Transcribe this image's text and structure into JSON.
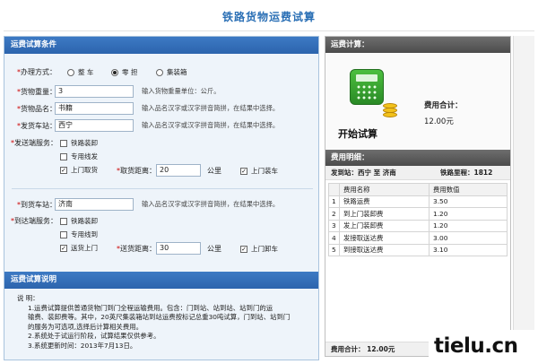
{
  "page": {
    "title": "铁路货物运费试算"
  },
  "conditions": {
    "title": "运费试算条件",
    "method": {
      "label": "办理方式：",
      "options": [
        "整 车",
        "零 担",
        "集装箱"
      ],
      "selected_index": 1
    },
    "weight": {
      "label": "货物重量：",
      "value": "3",
      "hint": "输入货物重量单位：公斤。"
    },
    "goods": {
      "label": "货物品名：",
      "value": "书籍",
      "hint": "输入品名汉字或汉字拼音简拼，在结果中选择。"
    },
    "origin": {
      "label": "发货车站：",
      "value": "西宁",
      "hint": "输入品名汉字或汉字拼音简拼，在结果中选择。"
    },
    "send_service": {
      "label": "发送端服务：",
      "options": [
        "铁路装卸",
        "专用线发",
        "上门取货"
      ],
      "checked": [
        false,
        false,
        true
      ],
      "distance_label": "取货距离：",
      "distance_value": "20",
      "distance_unit": "公里",
      "extra_label": "上门装车",
      "extra_checked": true
    },
    "dest": {
      "label": "到货车站：",
      "value": "济南",
      "hint": "输入品名汉字或汉字拼音简拼，在结果中选择。"
    },
    "arrive_service": {
      "label": "到达端服务：",
      "options": [
        "铁路装卸",
        "专用线到",
        "送货上门"
      ],
      "checked": [
        false,
        false,
        true
      ],
      "distance_label": "送货距离：",
      "distance_value": "30",
      "distance_unit": "公里",
      "extra_label": "上门卸车",
      "extra_checked": true
    }
  },
  "notes": {
    "title": "运费试算说明",
    "heading": "说 明：",
    "lines": [
      "1.运费试算提供普通货物门到门全程运输费用。包含：门到站、站到站、站到门的运",
      "输费、装卸费等。其中，20英尺集装箱站到站运费按标记总重30吨试算，门到站、站到门",
      "的服务为可选项,选择后计算相关费用。",
      "2.系统处于试运行阶段，试算结果仅供参考。",
      "3.系统更新时间：2013年7月13日。"
    ]
  },
  "calc": {
    "title": "运费计算：",
    "button_label": "开始试算",
    "total_label": "费用合计：",
    "total_value": "12.00元",
    "icon": "calculator-coins-icon"
  },
  "detail": {
    "title": "费用明细：",
    "route_label": "发到站：西宁 至 济南",
    "distance_label": "铁路里程：1812",
    "columns": [
      "费用名称",
      "费用数值"
    ],
    "rows": [
      {
        "idx": "1",
        "name": "铁路运费",
        "value": "3.50"
      },
      {
        "idx": "2",
        "name": "到上门装卸费",
        "value": "1.20"
      },
      {
        "idx": "3",
        "name": "发上门装卸费",
        "value": "1.20"
      },
      {
        "idx": "4",
        "name": "发接取送达费",
        "value": "3.00"
      },
      {
        "idx": "5",
        "name": "到接取送达费",
        "value": "3.10"
      }
    ],
    "footer": "费用合计：  12.00元"
  },
  "watermark": "tielu.cn"
}
